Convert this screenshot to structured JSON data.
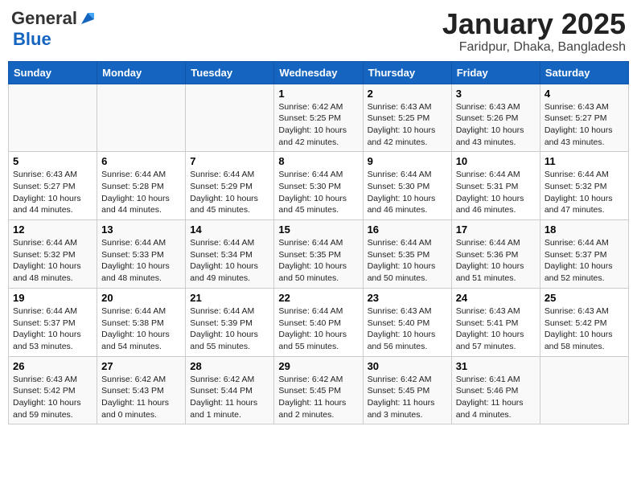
{
  "logo": {
    "general": "General",
    "blue": "Blue"
  },
  "header": {
    "title": "January 2025",
    "subtitle": "Faridpur, Dhaka, Bangladesh"
  },
  "days_of_week": [
    "Sunday",
    "Monday",
    "Tuesday",
    "Wednesday",
    "Thursday",
    "Friday",
    "Saturday"
  ],
  "weeks": [
    [
      null,
      null,
      null,
      {
        "day": 1,
        "sunrise": "6:42 AM",
        "sunset": "5:25 PM",
        "daylight": "10 hours and 42 minutes."
      },
      {
        "day": 2,
        "sunrise": "6:43 AM",
        "sunset": "5:25 PM",
        "daylight": "10 hours and 42 minutes."
      },
      {
        "day": 3,
        "sunrise": "6:43 AM",
        "sunset": "5:26 PM",
        "daylight": "10 hours and 43 minutes."
      },
      {
        "day": 4,
        "sunrise": "6:43 AM",
        "sunset": "5:27 PM",
        "daylight": "10 hours and 43 minutes."
      }
    ],
    [
      {
        "day": 5,
        "sunrise": "6:43 AM",
        "sunset": "5:27 PM",
        "daylight": "10 hours and 44 minutes."
      },
      {
        "day": 6,
        "sunrise": "6:44 AM",
        "sunset": "5:28 PM",
        "daylight": "10 hours and 44 minutes."
      },
      {
        "day": 7,
        "sunrise": "6:44 AM",
        "sunset": "5:29 PM",
        "daylight": "10 hours and 45 minutes."
      },
      {
        "day": 8,
        "sunrise": "6:44 AM",
        "sunset": "5:30 PM",
        "daylight": "10 hours and 45 minutes."
      },
      {
        "day": 9,
        "sunrise": "6:44 AM",
        "sunset": "5:30 PM",
        "daylight": "10 hours and 46 minutes."
      },
      {
        "day": 10,
        "sunrise": "6:44 AM",
        "sunset": "5:31 PM",
        "daylight": "10 hours and 46 minutes."
      },
      {
        "day": 11,
        "sunrise": "6:44 AM",
        "sunset": "5:32 PM",
        "daylight": "10 hours and 47 minutes."
      }
    ],
    [
      {
        "day": 12,
        "sunrise": "6:44 AM",
        "sunset": "5:32 PM",
        "daylight": "10 hours and 48 minutes."
      },
      {
        "day": 13,
        "sunrise": "6:44 AM",
        "sunset": "5:33 PM",
        "daylight": "10 hours and 48 minutes."
      },
      {
        "day": 14,
        "sunrise": "6:44 AM",
        "sunset": "5:34 PM",
        "daylight": "10 hours and 49 minutes."
      },
      {
        "day": 15,
        "sunrise": "6:44 AM",
        "sunset": "5:35 PM",
        "daylight": "10 hours and 50 minutes."
      },
      {
        "day": 16,
        "sunrise": "6:44 AM",
        "sunset": "5:35 PM",
        "daylight": "10 hours and 50 minutes."
      },
      {
        "day": 17,
        "sunrise": "6:44 AM",
        "sunset": "5:36 PM",
        "daylight": "10 hours and 51 minutes."
      },
      {
        "day": 18,
        "sunrise": "6:44 AM",
        "sunset": "5:37 PM",
        "daylight": "10 hours and 52 minutes."
      }
    ],
    [
      {
        "day": 19,
        "sunrise": "6:44 AM",
        "sunset": "5:37 PM",
        "daylight": "10 hours and 53 minutes."
      },
      {
        "day": 20,
        "sunrise": "6:44 AM",
        "sunset": "5:38 PM",
        "daylight": "10 hours and 54 minutes."
      },
      {
        "day": 21,
        "sunrise": "6:44 AM",
        "sunset": "5:39 PM",
        "daylight": "10 hours and 55 minutes."
      },
      {
        "day": 22,
        "sunrise": "6:44 AM",
        "sunset": "5:40 PM",
        "daylight": "10 hours and 55 minutes."
      },
      {
        "day": 23,
        "sunrise": "6:43 AM",
        "sunset": "5:40 PM",
        "daylight": "10 hours and 56 minutes."
      },
      {
        "day": 24,
        "sunrise": "6:43 AM",
        "sunset": "5:41 PM",
        "daylight": "10 hours and 57 minutes."
      },
      {
        "day": 25,
        "sunrise": "6:43 AM",
        "sunset": "5:42 PM",
        "daylight": "10 hours and 58 minutes."
      }
    ],
    [
      {
        "day": 26,
        "sunrise": "6:43 AM",
        "sunset": "5:42 PM",
        "daylight": "10 hours and 59 minutes."
      },
      {
        "day": 27,
        "sunrise": "6:42 AM",
        "sunset": "5:43 PM",
        "daylight": "11 hours and 0 minutes."
      },
      {
        "day": 28,
        "sunrise": "6:42 AM",
        "sunset": "5:44 PM",
        "daylight": "11 hours and 1 minute."
      },
      {
        "day": 29,
        "sunrise": "6:42 AM",
        "sunset": "5:45 PM",
        "daylight": "11 hours and 2 minutes."
      },
      {
        "day": 30,
        "sunrise": "6:42 AM",
        "sunset": "5:45 PM",
        "daylight": "11 hours and 3 minutes."
      },
      {
        "day": 31,
        "sunrise": "6:41 AM",
        "sunset": "5:46 PM",
        "daylight": "11 hours and 4 minutes."
      },
      null
    ]
  ]
}
